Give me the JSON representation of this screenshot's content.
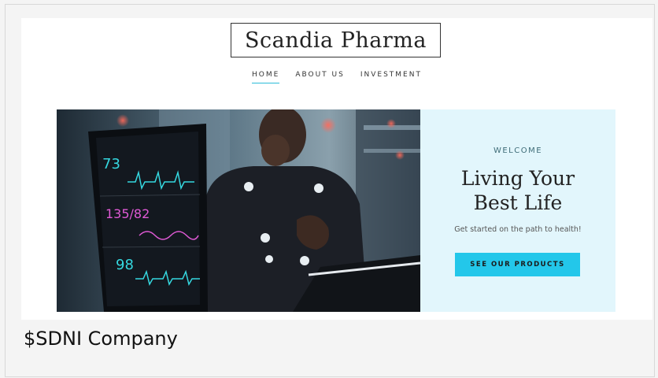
{
  "site": {
    "logo_text": "Scandia Pharma",
    "nav": [
      {
        "label": "HOME",
        "active": true
      },
      {
        "label": "ABOUT US",
        "active": false
      },
      {
        "label": "INVESTMENT",
        "active": false
      }
    ]
  },
  "hero": {
    "monitor_readings": {
      "heart_rate": "73",
      "blood_pressure": "135/82",
      "spo2": "98"
    },
    "welcome": "WELCOME",
    "headline_line1": "Living Your",
    "headline_line2": "Best Life",
    "subtext": "Get started on the path to health!",
    "cta_label": "SEE OUR PRODUCTS"
  },
  "caption": "$SDNI Company",
  "colors": {
    "accent": "#23c7ea",
    "panel_bg": "#e2f6fc",
    "nav_underline": "#2bbcd8"
  }
}
